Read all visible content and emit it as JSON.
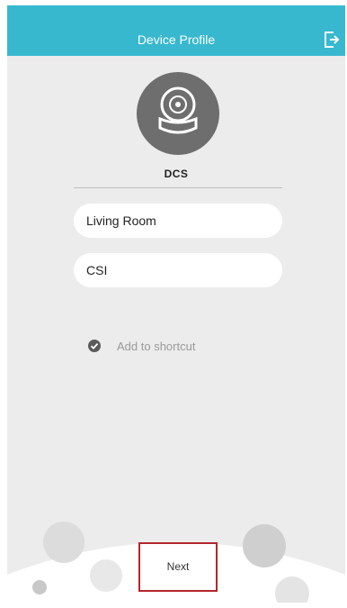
{
  "header": {
    "title": "Device Profile",
    "logout_icon": "logout-icon",
    "color": "#37b8cf"
  },
  "device": {
    "avatar_icon": "camera-icon",
    "name": "DCS"
  },
  "form": {
    "name_value": "Living Room",
    "pin_value": "CSI"
  },
  "shortcut": {
    "label": "Add to shortcut",
    "checked": true
  },
  "footer": {
    "next_label": "Next",
    "highlight_color": "#b3262c"
  }
}
